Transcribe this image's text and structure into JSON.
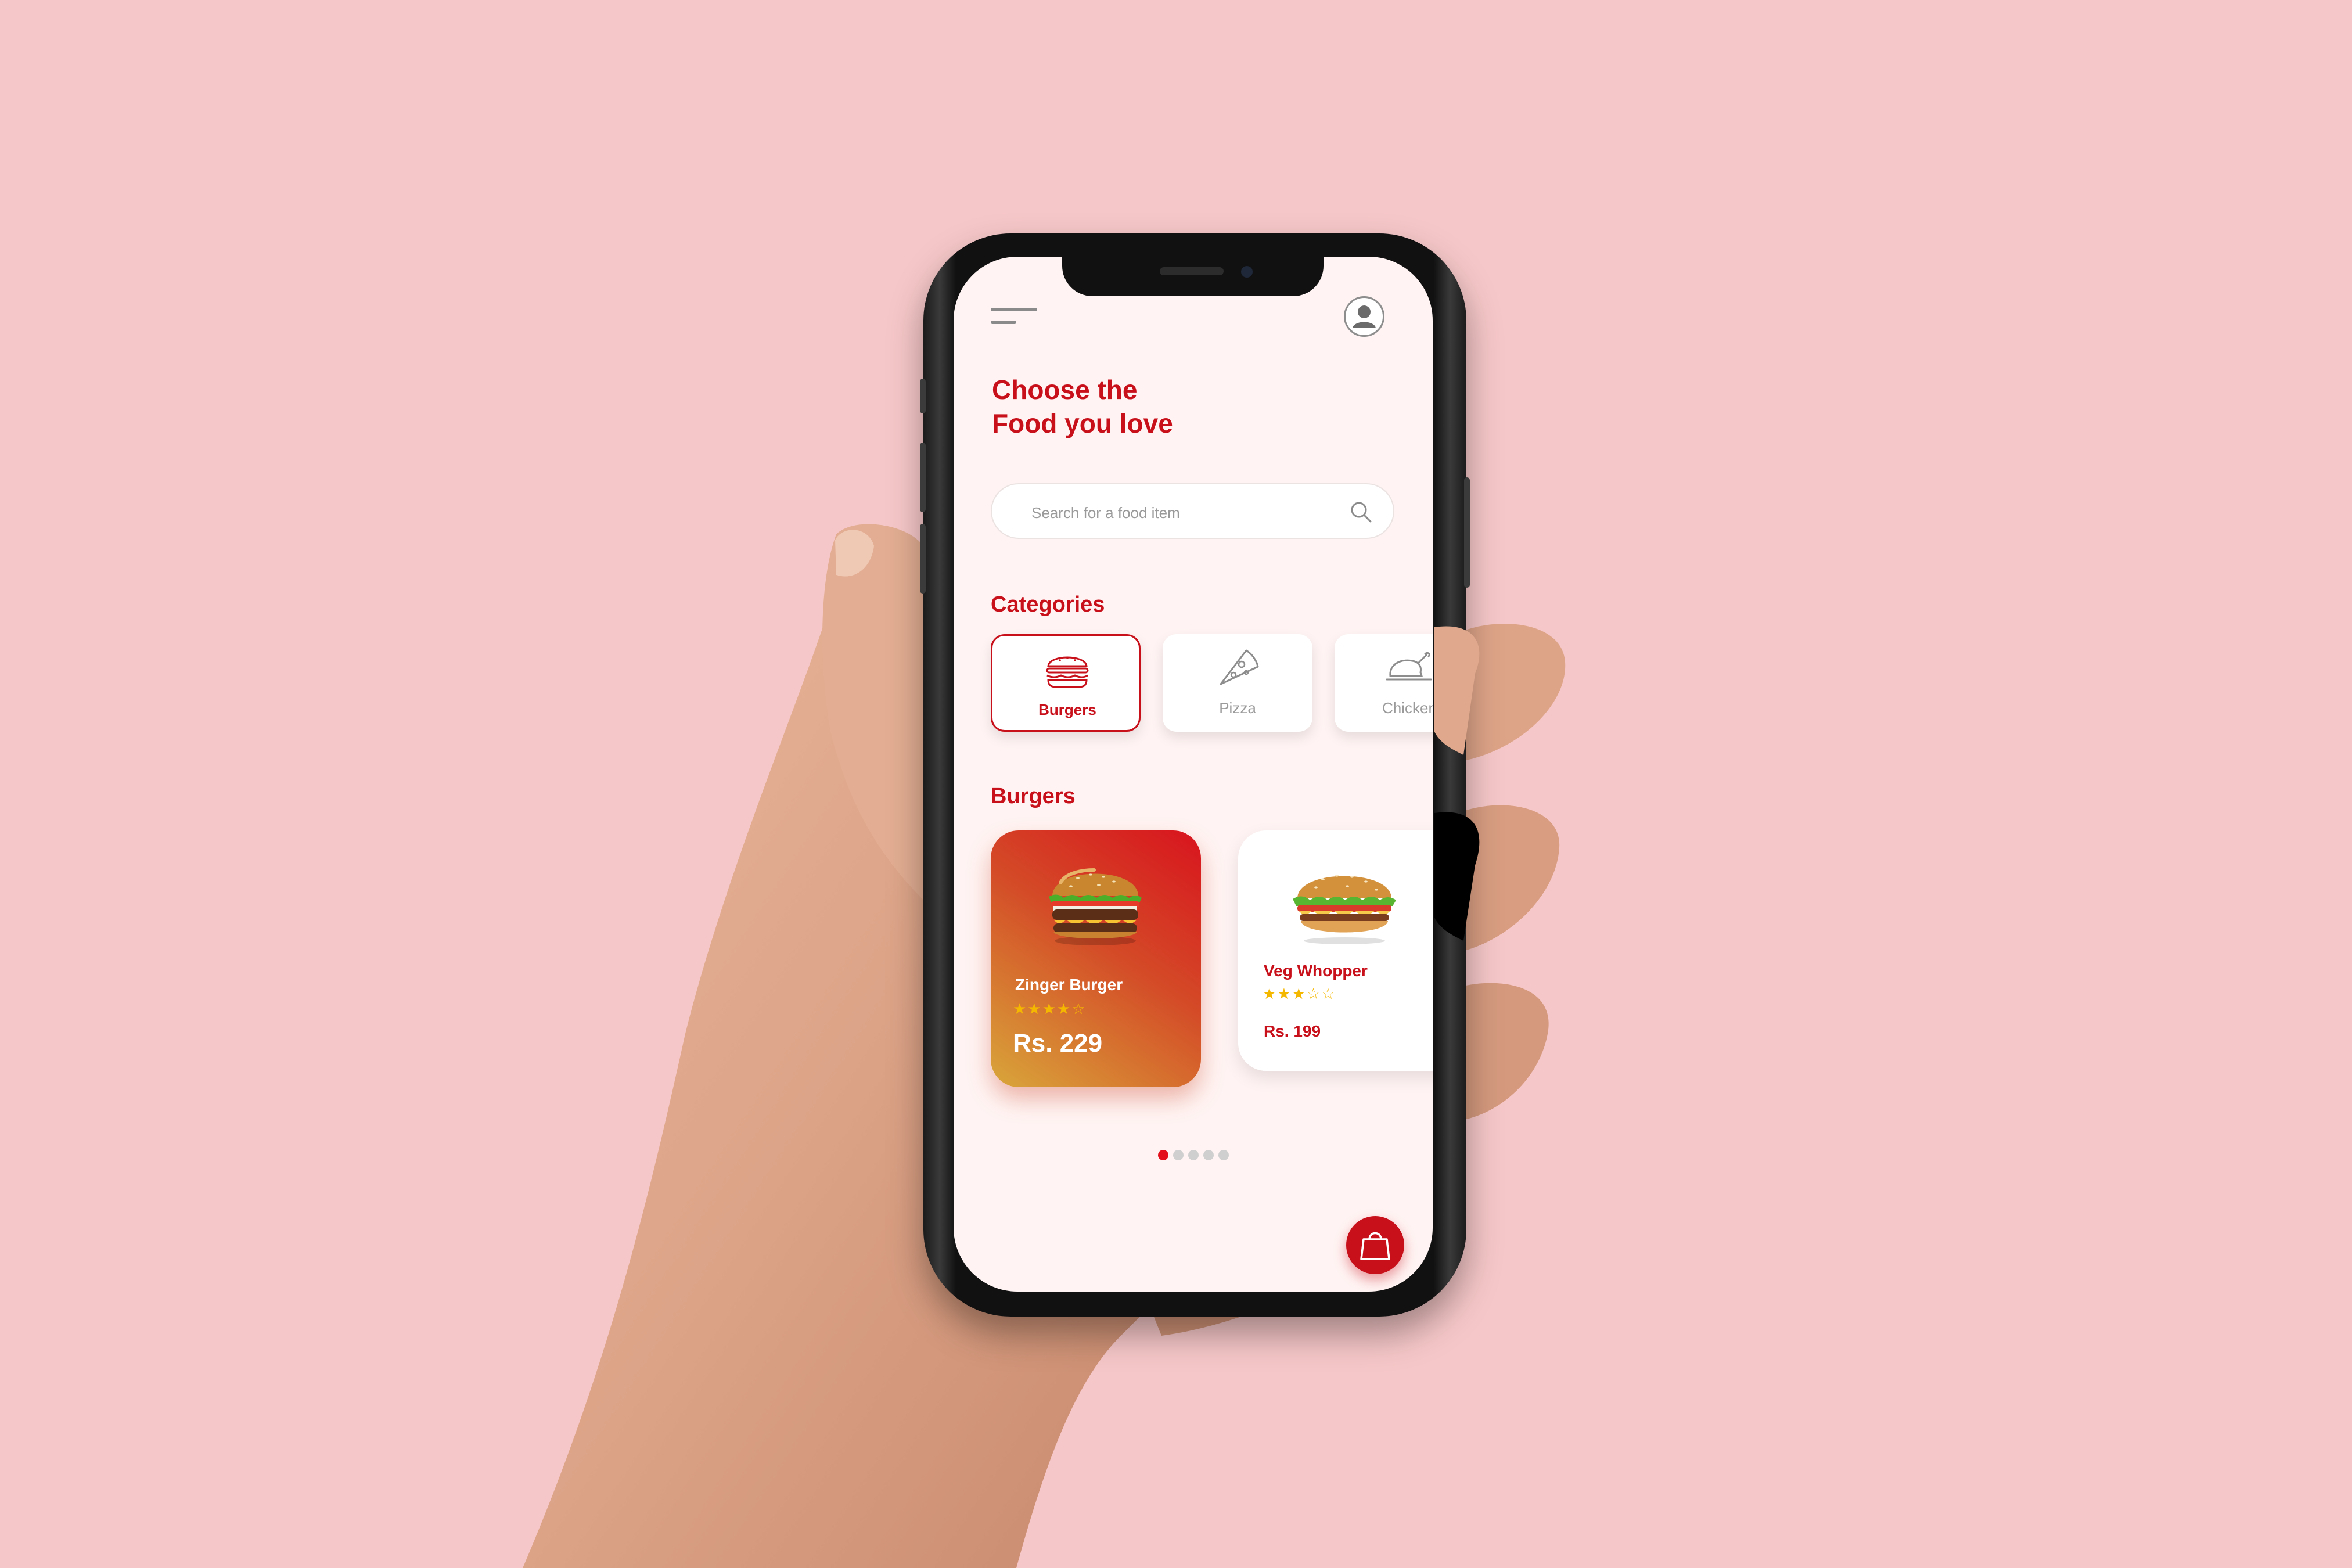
{
  "app": {
    "headline_line1": "Choose the",
    "headline_line2": "Food you love",
    "search": {
      "placeholder": "Search for a food item"
    },
    "categories_title": "Categories",
    "categories": [
      {
        "label": "Burgers",
        "icon": "burger-icon",
        "selected": true
      },
      {
        "label": "Pizza",
        "icon": "pizza-icon",
        "selected": false
      },
      {
        "label": "Chicken",
        "icon": "chicken-icon",
        "selected": false
      }
    ],
    "section_title": "Burgers",
    "items": [
      {
        "name": "Zinger Burger",
        "rating": 4,
        "max_rating": 5,
        "price": "Rs. 229"
      },
      {
        "name": "Veg Whopper",
        "rating": 3,
        "max_rating": 5,
        "price": "Rs. 199"
      }
    ],
    "pagination": {
      "current": 1,
      "total": 5
    }
  },
  "colors": {
    "background": "#f6c7c8",
    "accent": "#c8101b",
    "screen": "#fff4f3",
    "star": "#f5b800"
  }
}
